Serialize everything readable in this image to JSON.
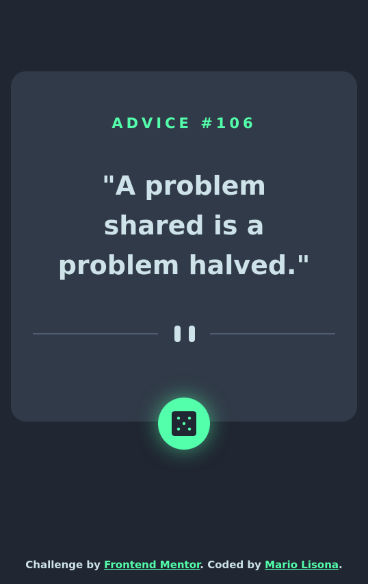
{
  "advice": {
    "heading": "ADVICE #106",
    "quote": "\"A problem shared is a problem halved.\""
  },
  "divider": {
    "icon": "pause-icon"
  },
  "dice_button": {
    "icon": "dice-icon",
    "accent_color": "#53ffab"
  },
  "footer": {
    "prefix": "Challenge by ",
    "link1": "Frontend Mentor",
    "middle": ". Coded by ",
    "link2": "Mario Lisona",
    "suffix": "."
  },
  "colors": {
    "background": "#202632",
    "card": "#313a48",
    "accent": "#53ffab",
    "text": "#cee3e9",
    "divider": "#4f5d74"
  }
}
